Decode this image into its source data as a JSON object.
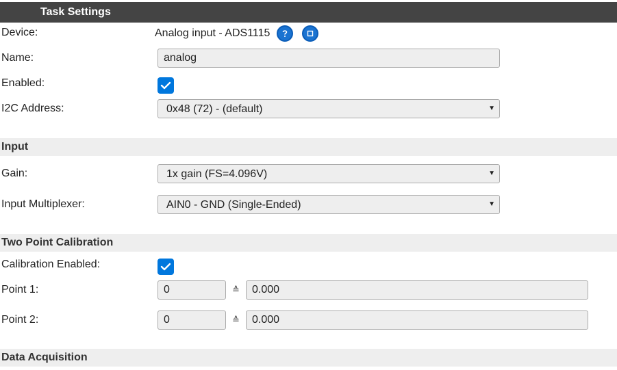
{
  "header": {
    "title": "Task Settings"
  },
  "device": {
    "label": "Device:",
    "value": "Analog input - ADS1115"
  },
  "name": {
    "label": "Name:",
    "value": "analog"
  },
  "enabled": {
    "label": "Enabled:",
    "checked": true
  },
  "i2c": {
    "label": "I2C Address:",
    "selected": "0x48 (72) - (default)"
  },
  "sections": {
    "input": "Input",
    "calibration": "Two Point Calibration",
    "acquisition": "Data Acquisition"
  },
  "gain": {
    "label": "Gain:",
    "selected": "1x gain (FS=4.096V)"
  },
  "multiplexer": {
    "label": "Input Multiplexer:",
    "selected": "AIN0 - GND (Single-Ended)"
  },
  "calibration_enabled": {
    "label": "Calibration Enabled:",
    "checked": true
  },
  "point1": {
    "label": "Point 1:",
    "raw": "0",
    "symbol": "≙",
    "value": "0.000"
  },
  "point2": {
    "label": "Point 2:",
    "raw": "0",
    "symbol": "≙",
    "value": "0.000"
  },
  "icons": {
    "help": "question-icon",
    "info": "square-icon",
    "check": "check-icon",
    "dropdown": "triangle-down-icon"
  },
  "colors": {
    "header_bg": "#444444",
    "section_bg": "#eeeeee",
    "accent": "#0077dd"
  }
}
